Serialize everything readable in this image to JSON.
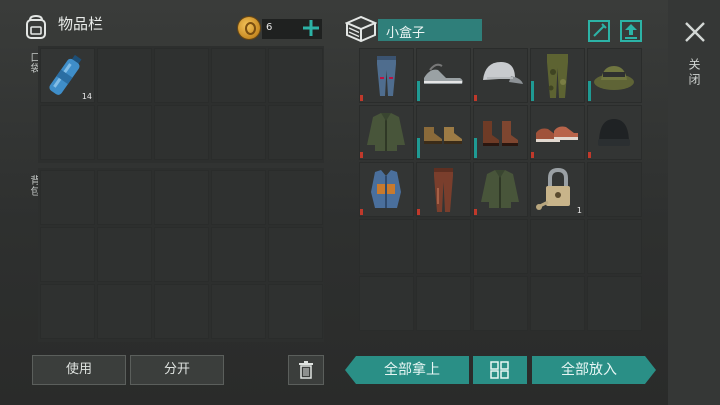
{
  "inventory": {
    "title": "物品栏",
    "coin_count": "6",
    "pocket_label": "口袋",
    "backpack_label": "背包",
    "pocket_items": [
      {
        "icon": "water-bottle-icon",
        "qty": "14"
      }
    ]
  },
  "actions": {
    "use_label": "使用",
    "split_label": "分开"
  },
  "container": {
    "title": "小盒子",
    "take_all_label": "全部拿上",
    "put_all_label": "全部放入",
    "items": [
      {
        "icon": "jeans-icon",
        "bar": "red"
      },
      {
        "icon": "sneakers-icon",
        "bar": "teal"
      },
      {
        "icon": "cap-icon",
        "bar": "red"
      },
      {
        "icon": "camo-pants-icon",
        "bar": "teal"
      },
      {
        "icon": "camo-hat-icon",
        "bar": "teal"
      },
      {
        "icon": "jacket-icon",
        "bar": "red"
      },
      {
        "icon": "tan-boots-icon",
        "bar": "teal"
      },
      {
        "icon": "brown-boots-icon",
        "bar": "teal"
      },
      {
        "icon": "red-shoes-icon",
        "bar": "red"
      },
      {
        "icon": "beanie-icon",
        "bar": "red"
      },
      {
        "icon": "vest-icon",
        "bar": "red"
      },
      {
        "icon": "brown-pants-icon",
        "bar": "red"
      },
      {
        "icon": "jacket-icon",
        "bar": "red"
      },
      {
        "icon": "padlock-icon",
        "bar": "",
        "qty": "1"
      }
    ]
  },
  "close_label": "关闭",
  "colors": {
    "accent": "#2a8f86",
    "durability_red": "#c0392b",
    "durability_teal": "#1f9a93"
  }
}
